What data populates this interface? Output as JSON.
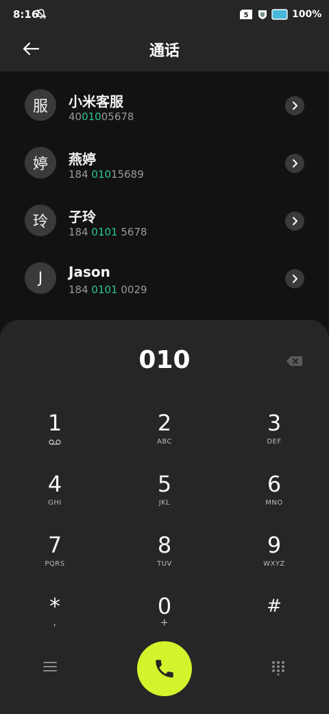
{
  "status_bar": {
    "time": "8:16",
    "battery": "100%"
  },
  "header": {
    "title": "通话"
  },
  "contacts": [
    {
      "avatar": "服",
      "name": "小米客服",
      "number_pre": "40",
      "number_hl": "010",
      "number_post": "05678"
    },
    {
      "avatar": "婷",
      "name": "燕婷",
      "number_pre": "184 ",
      "number_hl": "010",
      "number_post": "15689"
    },
    {
      "avatar": "玲",
      "name": "子玲",
      "number_pre": "184 ",
      "number_hl": "0101",
      "number_post": " 5678"
    },
    {
      "avatar": "J",
      "name": "Jason",
      "number_pre": "184 ",
      "number_hl": "0101",
      "number_post": " 0029"
    }
  ],
  "dialpad": {
    "input": "010",
    "keys": [
      {
        "digit": "1",
        "letters": ""
      },
      {
        "digit": "2",
        "letters": "ABC"
      },
      {
        "digit": "3",
        "letters": "DEF"
      },
      {
        "digit": "4",
        "letters": "GHI"
      },
      {
        "digit": "5",
        "letters": "JKL"
      },
      {
        "digit": "6",
        "letters": "MNO"
      },
      {
        "digit": "7",
        "letters": "PQRS"
      },
      {
        "digit": "8",
        "letters": "TUV"
      },
      {
        "digit": "9",
        "letters": "WXYZ"
      },
      {
        "digit": "*",
        "letters": ","
      },
      {
        "digit": "0",
        "letters": "+"
      },
      {
        "digit": "#",
        "letters": ""
      }
    ]
  },
  "colors": {
    "accent_call": "#d4f32c",
    "highlight_match": "#2cc78f",
    "sheet_background": "#262626",
    "page_background": "#121212"
  },
  "icons": [
    "bell-off-icon",
    "sim-icon",
    "shield-icon",
    "battery-icon",
    "back-icon",
    "chevron-right-icon",
    "delete-icon",
    "voicemail-icon",
    "menu-icon",
    "phone-icon",
    "grid-icon"
  ]
}
